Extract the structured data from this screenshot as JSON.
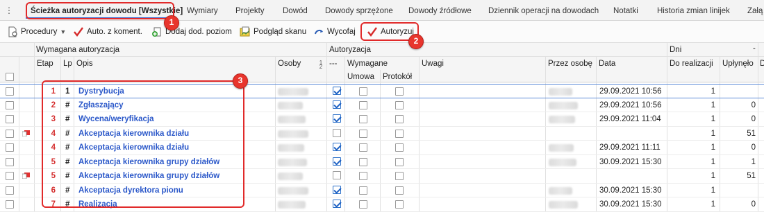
{
  "tabs": [
    {
      "label": "Ścieżka autoryzacji dowodu [Wszystkie]",
      "active": true
    },
    {
      "label": "Wymiary"
    },
    {
      "label": "Projekty"
    },
    {
      "label": "Dowód"
    },
    {
      "label": "Dowody sprzężone"
    },
    {
      "label": "Dowody źródłowe"
    },
    {
      "label": "Dziennik operacji na dowodach"
    },
    {
      "label": "Notatki"
    },
    {
      "label": "Historia zmian linijek"
    },
    {
      "label": "Załą"
    }
  ],
  "toolbar": {
    "procedury": "Procedury",
    "auto_z_koment": "Auto. z koment.",
    "dodaj_dod_poziom": "Dodaj dod. poziom",
    "podglad_skanu": "Podgląd skanu",
    "wycofaj": "Wycofaj",
    "autoryzuj": "Autoryzuj"
  },
  "badges": [
    "1",
    "2",
    "3"
  ],
  "headers": {
    "group_wymagana": "Wymagana autoryzacja",
    "group_autoryzacja": "Autoryzacja",
    "group_dni": "Dni",
    "etap": "Etap",
    "lp": "Lp",
    "opis": "Opis",
    "osoby": "Osoby",
    "dash": "---",
    "wymagane": "Wymagane",
    "umowa": "Umowa",
    "protokol": "Protokół",
    "uwagi": "Uwagi",
    "przez_osobe": "Przez osobę",
    "data": "Data",
    "do_realizacji": "Do realizacji",
    "uplynelo": "Upłynęło",
    "minus": "-",
    "d_cut": "D"
  },
  "rows": [
    {
      "etap": "1",
      "lp": "1",
      "opis": "Dystrybucja",
      "checked": true,
      "flag": false,
      "data": "29.09.2021 10:56",
      "do_realizacji": "1",
      "uplynelo": "",
      "selected": true
    },
    {
      "etap": "2",
      "lp": "#",
      "opis": "Zgłaszający",
      "checked": true,
      "flag": false,
      "data": "29.09.2021 10:56",
      "do_realizacji": "1",
      "uplynelo": "0"
    },
    {
      "etap": "3",
      "lp": "#",
      "opis": "Wycena/weryfikacja",
      "checked": true,
      "flag": false,
      "data": "29.09.2021 11:04",
      "do_realizacji": "1",
      "uplynelo": "0"
    },
    {
      "etap": "4",
      "lp": "#",
      "opis": "Akceptacja kierownika działu",
      "checked": false,
      "flag": true,
      "data": "",
      "do_realizacji": "1",
      "uplynelo": "51"
    },
    {
      "etap": "4",
      "lp": "#",
      "opis": "Akceptacja kierownika działu",
      "checked": true,
      "flag": false,
      "data": "29.09.2021 11:11",
      "do_realizacji": "1",
      "uplynelo": "0"
    },
    {
      "etap": "5",
      "lp": "#",
      "opis": "Akceptacja kierownika grupy działów",
      "checked": true,
      "flag": false,
      "data": "30.09.2021 15:30",
      "do_realizacji": "1",
      "uplynelo": "1"
    },
    {
      "etap": "5",
      "lp": "#",
      "opis": "Akceptacja kierownika grupy działów",
      "checked": false,
      "flag": true,
      "data": "",
      "do_realizacji": "1",
      "uplynelo": "51"
    },
    {
      "etap": "6",
      "lp": "#",
      "opis": "Akceptacja dyrektora pionu",
      "checked": true,
      "flag": false,
      "data": "30.09.2021 15:30",
      "do_realizacji": "1",
      "uplynelo": ""
    },
    {
      "etap": "7",
      "lp": "#",
      "opis": "Realizacja",
      "checked": true,
      "flag": false,
      "data": "30.09.2021 15:30",
      "do_realizacji": "1",
      "uplynelo": "0"
    }
  ],
  "colors": {
    "accent": "#3a6fd8",
    "annotation": "#e12a2a",
    "etap": "#d42d2d",
    "opis": "#2b58c9"
  }
}
